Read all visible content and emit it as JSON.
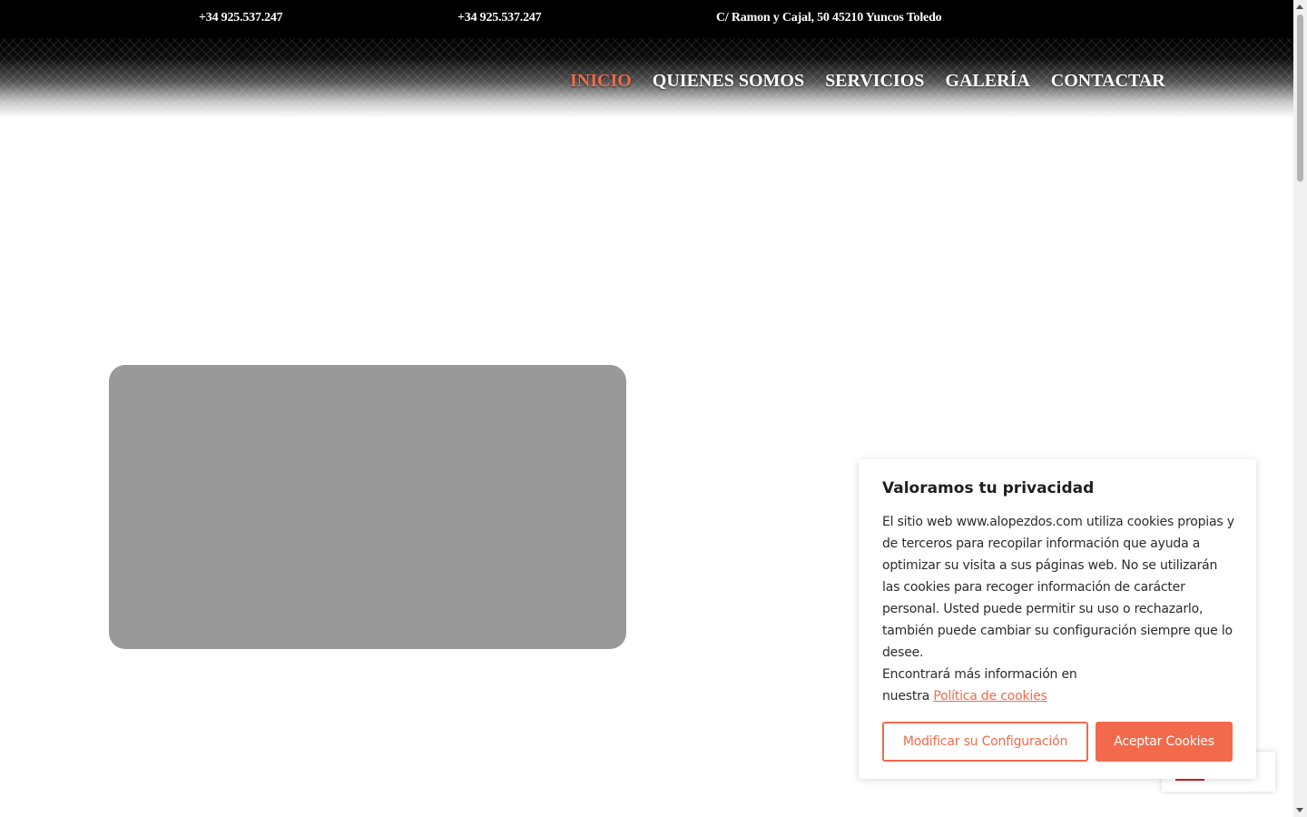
{
  "topbar": {
    "phone_primary": "+34 925.537.247",
    "phone_secondary": "+34 925.537.247",
    "address": "C/ Ramon y Cajal, 50  45210 Yuncos Toledo"
  },
  "nav": {
    "items": [
      {
        "label": "INICIO",
        "active": true
      },
      {
        "label": "QUIENES SOMOS",
        "active": false
      },
      {
        "label": "SERVICIOS",
        "active": false
      },
      {
        "label": "GALERÍA",
        "active": false
      },
      {
        "label": "CONTACTAR",
        "active": false
      }
    ]
  },
  "cookie_banner": {
    "title": "Valoramos tu privacidad",
    "body": "El sitio web www.alopezdos.com utiliza cookies propias y de terceros para recopilar información que ayuda a optimizar su visita a sus páginas web. No se utilizarán las cookies para recoger información de carácter personal. Usted puede permitir su uso o rechazarlo, también puede cambiar su configuración siempre que lo desee.",
    "more_info_prefix": "Encontrará más información en nuestra",
    "policy_link": "Política de cookies",
    "modify_button": "Modificar su Configuración",
    "accept_button": "Aceptar Cookies"
  },
  "colors": {
    "accent": "#f26a4b",
    "topbar_bg": "#000000",
    "image_placeholder": "#999999"
  }
}
